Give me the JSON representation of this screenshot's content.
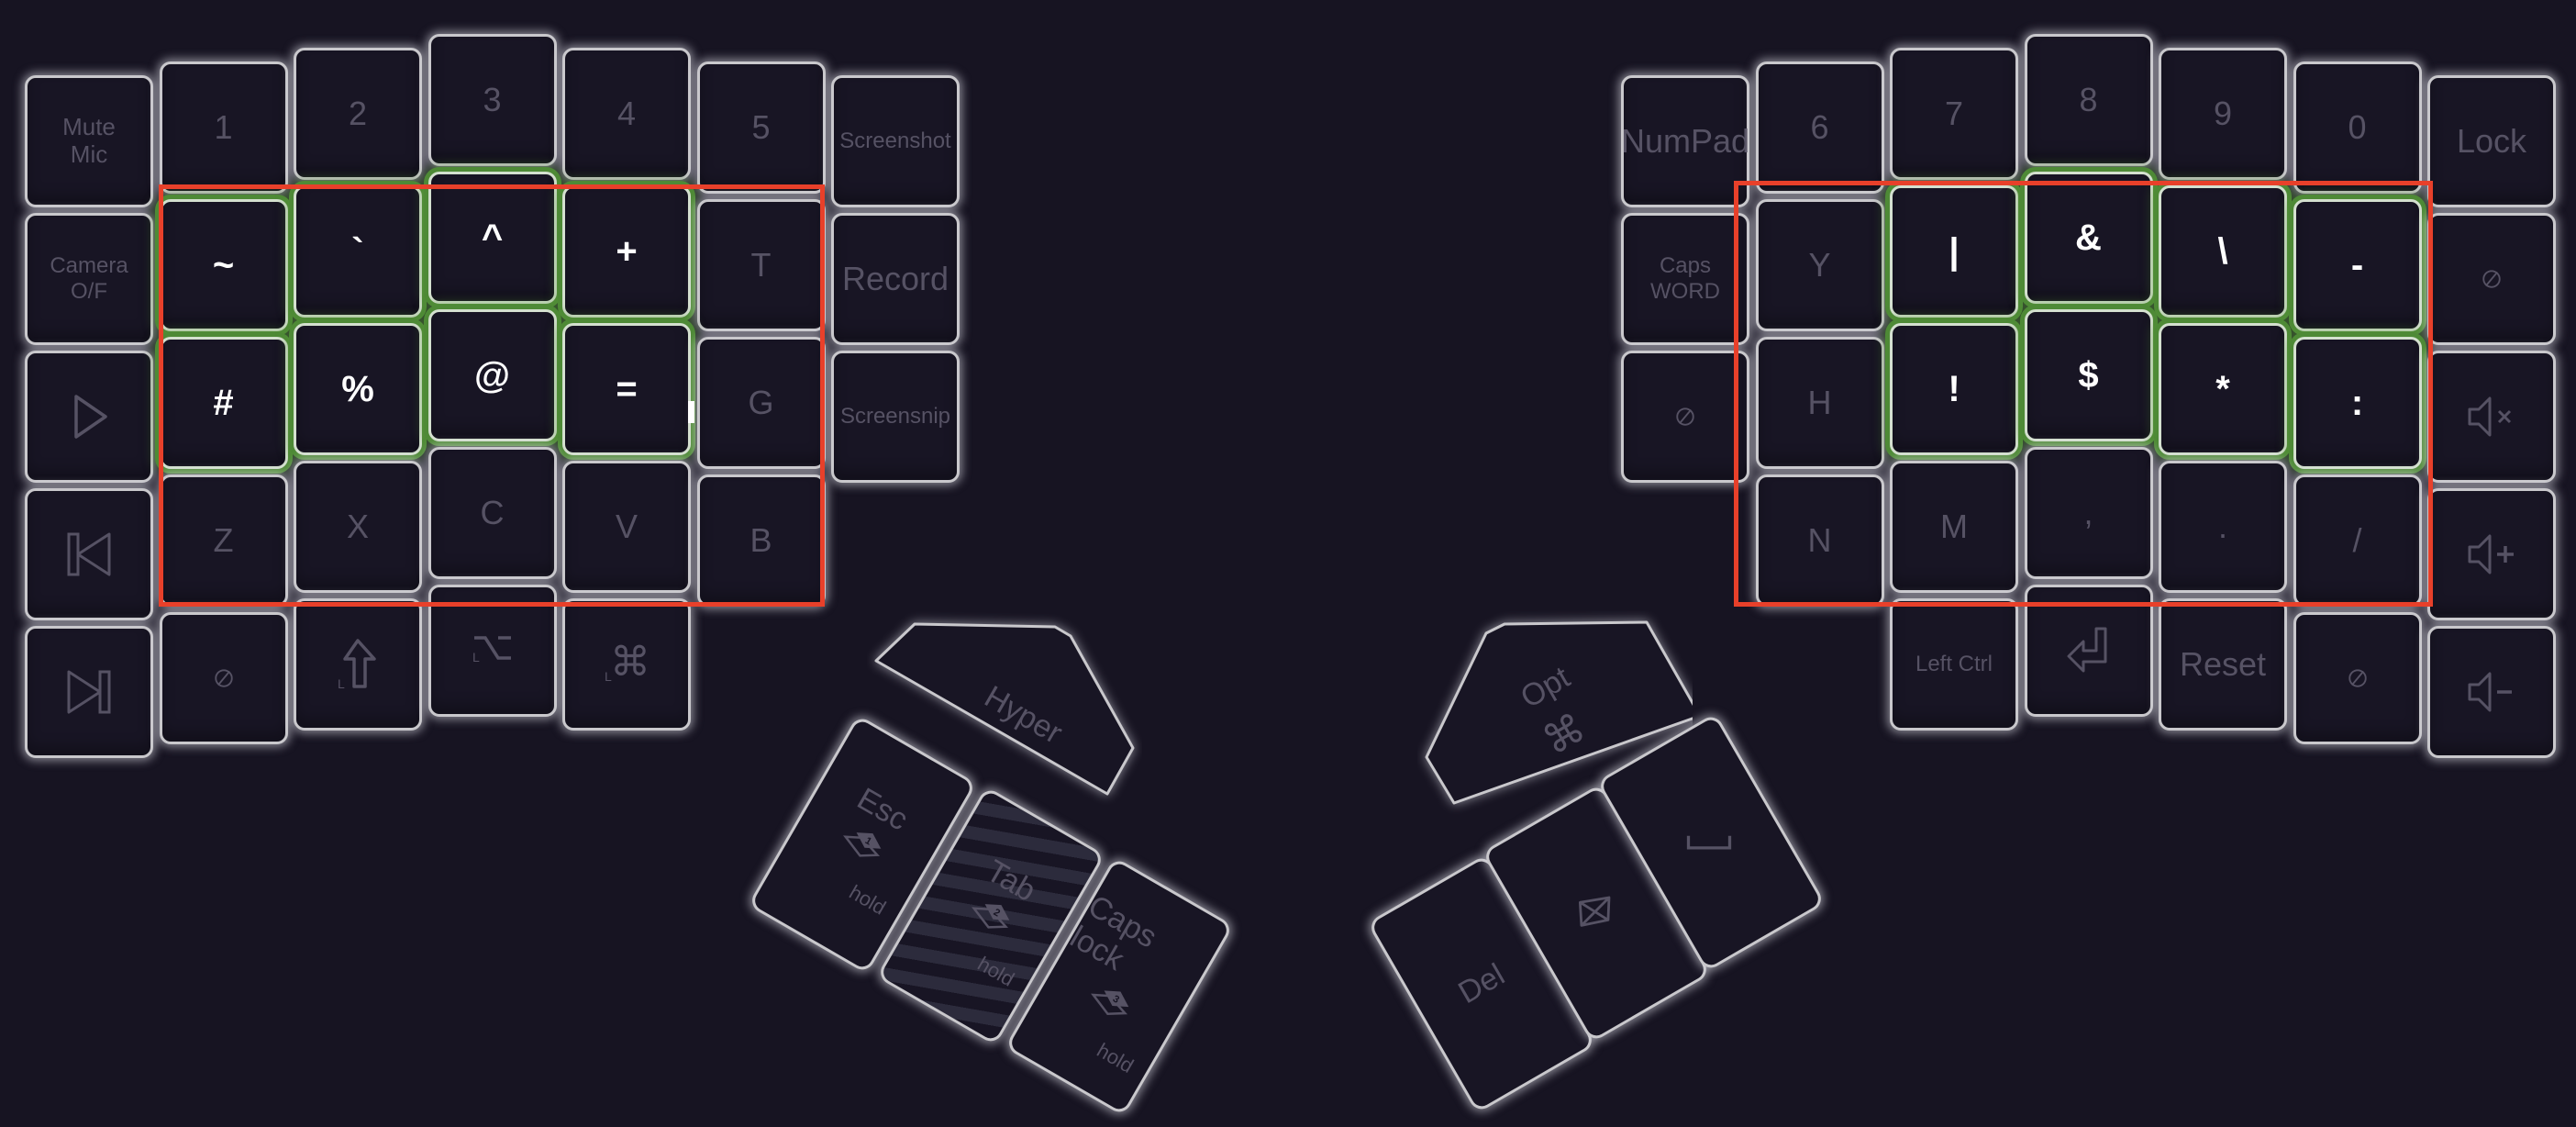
{
  "colors": {
    "background": "#171422",
    "key_fill": "#181524",
    "key_border": "#c9c8cc",
    "legend_inactive": "#565264",
    "legend_active": "#ffffff",
    "active_glow": "#4e8a36",
    "highlight_box": "#e8402a"
  },
  "left_half": {
    "rows": [
      [
        {
          "label": "Mute\nMic"
        },
        {
          "label": "1"
        },
        {
          "label": "2"
        },
        {
          "label": "3"
        },
        {
          "label": "4"
        },
        {
          "label": "5"
        },
        {
          "label": "Screenshot"
        }
      ],
      [
        {
          "label": "Camera\nO/F"
        },
        {
          "label": "~",
          "active": true
        },
        {
          "label": "`",
          "active": true
        },
        {
          "label": "^",
          "active": true
        },
        {
          "label": "+",
          "active": true
        },
        {
          "label": "T"
        },
        {
          "label": "Record"
        }
      ],
      [
        {
          "icon": "play-icon"
        },
        {
          "label": "#",
          "active": true
        },
        {
          "label": "%",
          "active": true
        },
        {
          "label": "@",
          "active": true
        },
        {
          "label": "=",
          "active": true
        },
        {
          "label": "G"
        },
        {
          "label": "Screensnip"
        }
      ],
      [
        {
          "icon": "previous-track-icon"
        },
        {
          "label": "Z"
        },
        {
          "label": "X"
        },
        {
          "label": "C"
        },
        {
          "label": "V"
        },
        {
          "label": "B"
        }
      ],
      [
        {
          "icon": "next-track-icon"
        },
        {
          "icon": "none-icon"
        },
        {
          "icon": "left-shift-icon"
        },
        {
          "icon": "left-option-icon"
        },
        {
          "icon": "left-command-icon"
        }
      ]
    ],
    "thumb": {
      "hyper": "Hyper",
      "esc": {
        "label": "Esc",
        "layer": "1",
        "hold": "hold"
      },
      "tab": {
        "label": "Tab",
        "layer": "2",
        "hold": "hold"
      },
      "caps": {
        "label": "Caps lock",
        "layer": "3",
        "hold": "hold"
      }
    }
  },
  "right_half": {
    "rows": [
      [
        {
          "label": "NumPad"
        },
        {
          "label": "6"
        },
        {
          "label": "7"
        },
        {
          "label": "8"
        },
        {
          "label": "9"
        },
        {
          "label": "0"
        },
        {
          "label": "Lock"
        }
      ],
      [
        {
          "label": "Caps\nWORD"
        },
        {
          "label": "Y"
        },
        {
          "label": "|",
          "active": true
        },
        {
          "label": "&",
          "active": true
        },
        {
          "label": "\\",
          "active": true
        },
        {
          "label": "-",
          "active": true
        },
        {
          "icon": "none-icon"
        }
      ],
      [
        {
          "icon": "none-icon"
        },
        {
          "label": "H"
        },
        {
          "label": "!",
          "active": true
        },
        {
          "label": "$",
          "active": true
        },
        {
          "label": "*",
          "active": true
        },
        {
          "label": ":",
          "active": true
        },
        {
          "icon": "volume-mute-icon"
        }
      ],
      [
        {
          "label": "N"
        },
        {
          "label": "M"
        },
        {
          "label": ","
        },
        {
          "label": "."
        },
        {
          "label": "/"
        },
        {
          "icon": "volume-up-icon"
        }
      ],
      [
        {
          "label": "Left Ctrl"
        },
        {
          "icon": "enter-icon"
        },
        {
          "label": "Reset"
        },
        {
          "icon": "none-icon"
        },
        {
          "icon": "volume-down-icon"
        }
      ]
    ],
    "thumb": {
      "opt": "Opt",
      "del": "Del",
      "meh": "meh-icon",
      "space": "space-icon"
    }
  }
}
